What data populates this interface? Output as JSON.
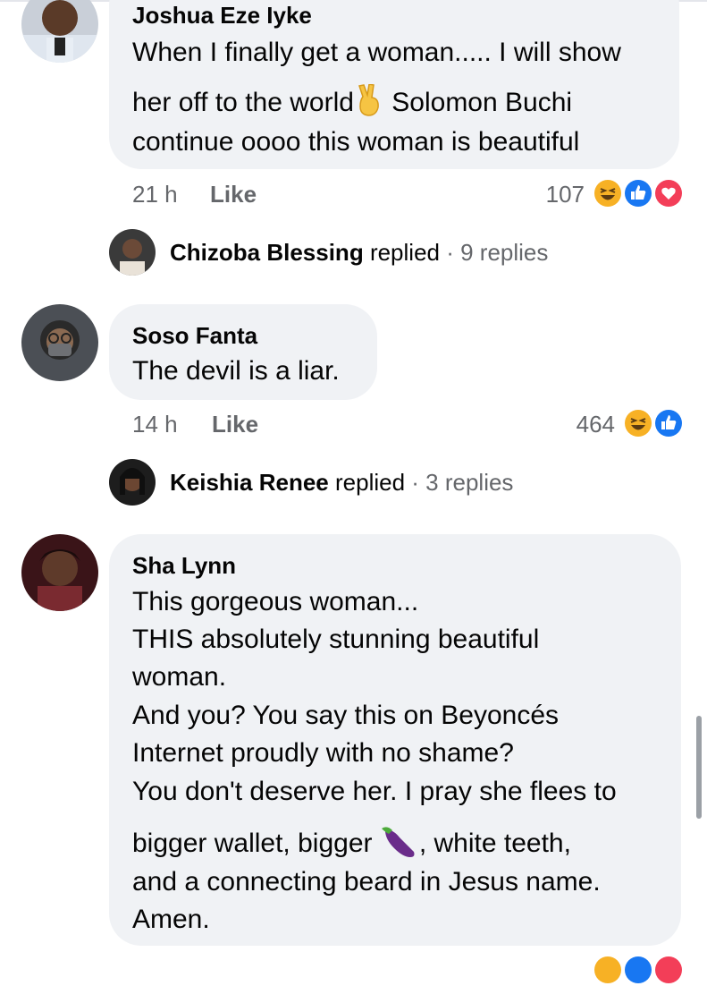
{
  "comments": [
    {
      "author": "Joshua Eze Iyke",
      "lines": [
        "When I finally get a woman..... I will show",
        "her off to the world",
        " Solomon Buchi",
        "continue oooo this woman is beautiful"
      ],
      "time": "21 h",
      "like": "Like",
      "reaction_count": "107",
      "reactions": [
        "haha-icon",
        "like-icon",
        "love-icon"
      ],
      "replies": {
        "name": "Chizoba Blessing",
        "verb": "replied",
        "sep": " · ",
        "count": "9 replies"
      }
    },
    {
      "author": "Soso Fanta",
      "lines": [
        "The devil is a liar."
      ],
      "time": "14 h",
      "like": "Like",
      "reaction_count": "464",
      "reactions": [
        "haha-icon",
        "like-icon"
      ],
      "replies": {
        "name": "Keishia Renee",
        "verb": "replied",
        "sep": " · ",
        "count": "3 replies"
      }
    },
    {
      "author": "Sha Lynn",
      "lines": [
        "This gorgeous woman...",
        "THIS absolutely stunning beautiful",
        "woman.",
        "And you? You say this on Beyoncés",
        "Internet proudly with no shame?",
        "You don't deserve her. I pray she flees to",
        "bigger wallet, bigger ",
        ", white teeth,",
        "and a connecting beard in Jesus name.",
        "Amen."
      ]
    }
  ],
  "colors": {
    "bubble": "#f0f2f5",
    "muted": "#65676b",
    "like_blue": "#1877f2",
    "love_red": "#f33e58",
    "haha_yellow": "#f7b125"
  }
}
